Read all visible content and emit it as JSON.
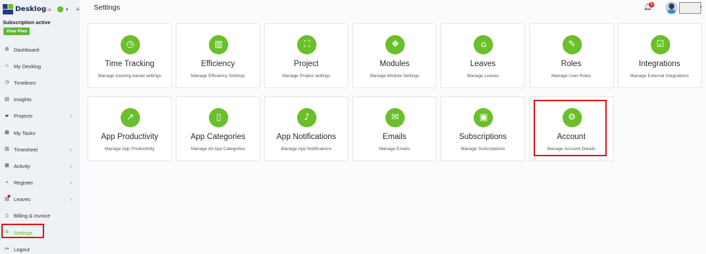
{
  "brand": {
    "name": "Desklog",
    "suffix": ".io"
  },
  "subscription": {
    "status": "Subscription active",
    "view_plan": "View Plan"
  },
  "nav": [
    {
      "label": "Dashboard",
      "icon": "dashboard-icon",
      "glyph": "◍",
      "chevron": false
    },
    {
      "label": "My Desklog",
      "icon": "home-icon",
      "glyph": "⌂",
      "chevron": false
    },
    {
      "label": "Timelines",
      "icon": "clock-icon",
      "glyph": "◷",
      "chevron": false
    },
    {
      "label": "Insights",
      "icon": "insights-icon",
      "glyph": "▤",
      "chevron": false
    },
    {
      "label": "Projects",
      "icon": "projects-icon",
      "glyph": "▰",
      "chevron": true
    },
    {
      "label": "My Tasks",
      "icon": "tasks-icon",
      "glyph": "▦",
      "chevron": false
    },
    {
      "label": "Timesheet",
      "icon": "timesheet-icon",
      "glyph": "▥",
      "chevron": true
    },
    {
      "label": "Activity",
      "icon": "activity-icon",
      "glyph": "▦",
      "chevron": true
    },
    {
      "label": "Register",
      "icon": "plus-icon",
      "glyph": "+",
      "chevron": true
    },
    {
      "label": "Leaves",
      "icon": "leaves-icon",
      "glyph": "▤",
      "chevron": true
    },
    {
      "label": "Billing & Invoice",
      "icon": "billing-icon",
      "glyph": "▯",
      "chevron": false
    },
    {
      "label": "Settings",
      "icon": "gear-icon",
      "glyph": "✲",
      "chevron": false,
      "active": true
    },
    {
      "label": "Logout",
      "icon": "logout-icon",
      "glyph": "↦",
      "chevron": false
    }
  ],
  "header": {
    "title": "Settings",
    "notification_count": "8"
  },
  "cards": [
    {
      "title": "Time Tracking",
      "desc": "Manage tracking based settings",
      "icon": "clock-icon",
      "glyph": "◷"
    },
    {
      "title": "Efficiency",
      "desc": "Manage Efficiency Settings",
      "icon": "bar-chart-icon",
      "glyph": "▥"
    },
    {
      "title": "Project",
      "desc": "Manage Project settings",
      "icon": "hierarchy-icon",
      "glyph": "⛶"
    },
    {
      "title": "Modules",
      "desc": "Manage Module Settings",
      "icon": "cubes-icon",
      "glyph": "❖"
    },
    {
      "title": "Leaves",
      "desc": "Manage Leaves",
      "icon": "house-icon",
      "glyph": "⌂"
    },
    {
      "title": "Roles",
      "desc": "Manage User Roles",
      "icon": "wrench-icon",
      "glyph": "✎"
    },
    {
      "title": "Integrations",
      "desc": "Manage External Integrations",
      "icon": "check-square-icon",
      "glyph": "☑"
    },
    {
      "title": "App Productivity",
      "desc": "Manage App Productivity",
      "icon": "line-chart-icon",
      "glyph": "↗"
    },
    {
      "title": "App Categories",
      "desc": "Manage All App Categories",
      "icon": "mobile-icon",
      "glyph": "▯"
    },
    {
      "title": "App Notifications",
      "desc": "Manage App Notifications",
      "icon": "bell-icon",
      "glyph": "♪"
    },
    {
      "title": "Emails",
      "desc": "Manage Emails",
      "icon": "envelope-icon",
      "glyph": "✉"
    },
    {
      "title": "Subscriptions",
      "desc": "Manage Subscriptions",
      "icon": "money-icon",
      "glyph": "▣"
    },
    {
      "title": "Account",
      "desc": "Manage Account Details",
      "icon": "gears-icon",
      "glyph": "⚙"
    }
  ],
  "colors": {
    "accent": "#6abf2a",
    "highlight": "#e01010",
    "badge": "#e02a2a"
  }
}
